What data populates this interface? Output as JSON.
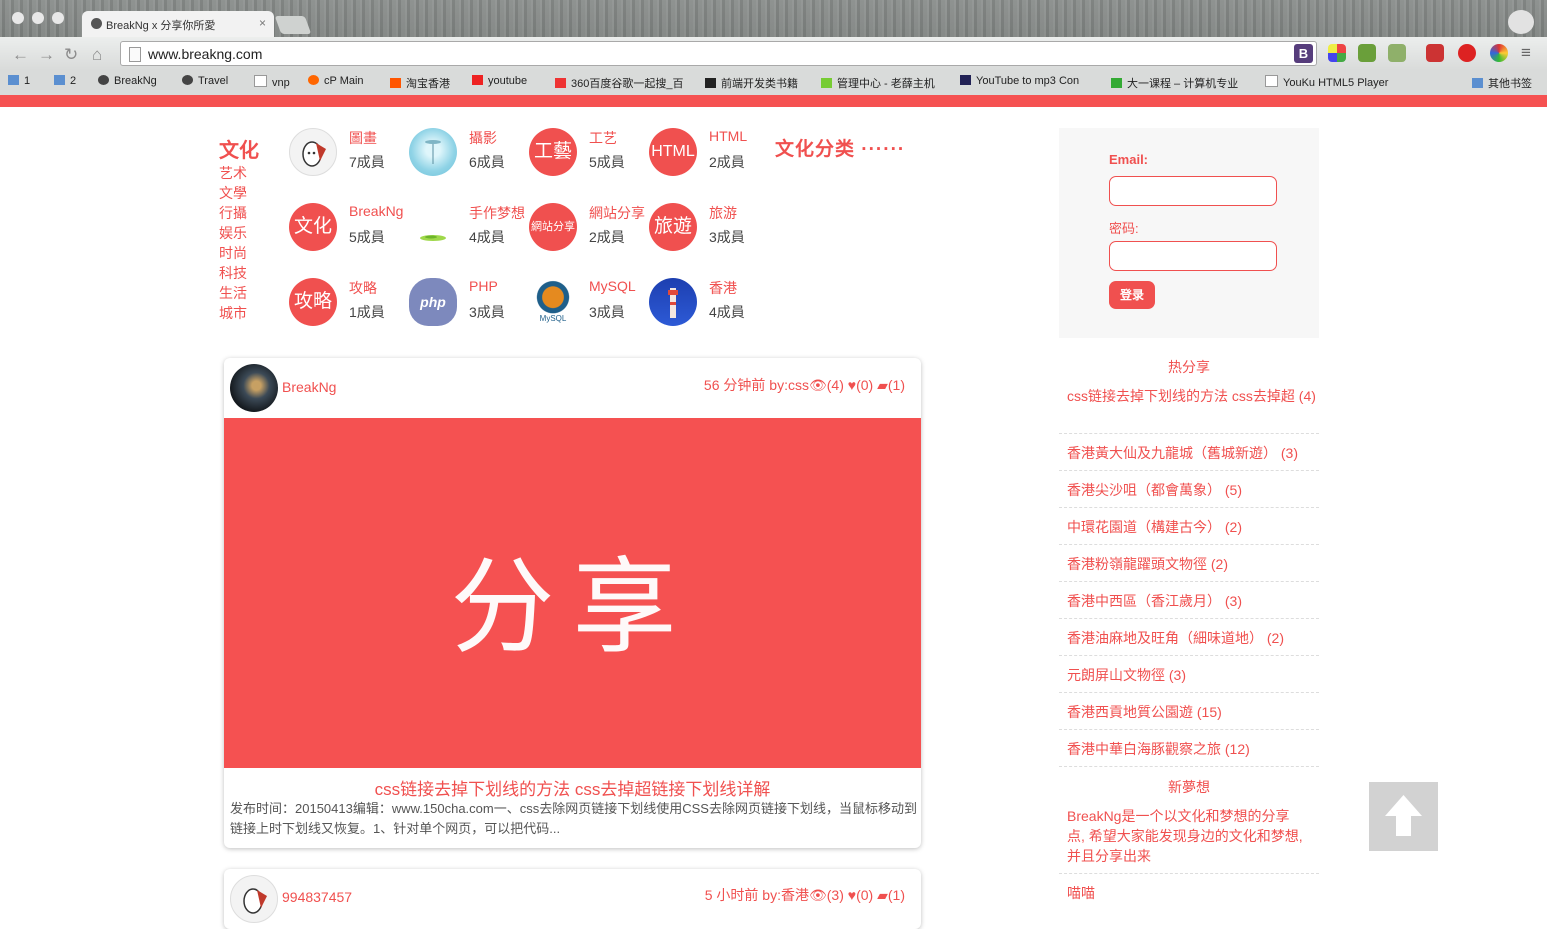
{
  "browser": {
    "tab_title": "BreakNg x 分享你所愛",
    "tab_close": "×",
    "url": "www.breakng.com",
    "url_ext_label": "B",
    "bookmarks": [
      {
        "label": "1"
      },
      {
        "label": "2"
      },
      {
        "label": "BreakNg"
      },
      {
        "label": "Travel"
      },
      {
        "label": "vnp"
      },
      {
        "label": "cP Main"
      },
      {
        "label": "淘宝香港"
      },
      {
        "label": "youtube"
      },
      {
        "label": "360百度谷歌一起搜_百"
      },
      {
        "label": "前端开发类书籍"
      },
      {
        "label": "管理中心 - 老薛主机"
      },
      {
        "label": "YouTube to mp3 Con"
      },
      {
        "label": "大一课程 – 计算机专业"
      },
      {
        "label": "YouKu HTML5 Player"
      },
      {
        "label": "其他书签"
      }
    ],
    "accent": "#f55151"
  },
  "categories": {
    "title": "文化",
    "list": [
      "艺术",
      "文學",
      "行攝",
      "娱乐",
      "时尚",
      "科技",
      "生活",
      "城市"
    ],
    "more": "文化分类 ······",
    "groups": [
      {
        "name": "圖畫",
        "count": "7成員",
        "icon": "",
        "icon_name": "drawing-character-icon"
      },
      {
        "name": "攝影",
        "count": "6成員",
        "icon": "",
        "icon_name": "camera-sky-icon"
      },
      {
        "name": "工艺",
        "count": "5成員",
        "icon": "工藝",
        "icon_name": "craft-icon"
      },
      {
        "name": "HTML",
        "count": "2成員",
        "icon": "HTML",
        "icon_name": "html-icon"
      },
      {
        "name": "BreakNg",
        "count": "5成員",
        "icon": "文化",
        "icon_name": "culture-icon"
      },
      {
        "name": "手作梦想",
        "count": "4成員",
        "icon": "",
        "icon_name": "handmade-icon"
      },
      {
        "name": "網站分享",
        "count": "2成員",
        "icon": "網站分享",
        "icon_name": "website-share-icon"
      },
      {
        "name": "旅游",
        "count": "3成員",
        "icon": "旅遊",
        "icon_name": "travel-icon"
      },
      {
        "name": "攻略",
        "count": "1成員",
        "icon": "攻略",
        "icon_name": "guide-icon"
      },
      {
        "name": "PHP",
        "count": "3成員",
        "icon": "php",
        "icon_name": "php-elephant-icon"
      },
      {
        "name": "MySQL",
        "count": "3成員",
        "icon": "MySQL",
        "icon_name": "mysql-icon"
      },
      {
        "name": "香港",
        "count": "4成員",
        "icon": "",
        "icon_name": "hongkong-tower-icon"
      }
    ]
  },
  "posts": [
    {
      "author": "BreakNg",
      "time": "56 分钟前",
      "by": "by:css",
      "views": "(4)",
      "likes": "(0)",
      "comments": "(1)",
      "hero_text": "分享",
      "title": "css链接去掉下划线的方法 css去掉超链接下划线详解",
      "excerpt": "发布时间：20150413编辑：www.150cha.com一、css去除网页链接下划线使用CSS去除网页链接下划线，当鼠标移动到链接上时下划线又恢复。1、针对单个网页，可以把代码..."
    },
    {
      "author": "994837457",
      "time": "5 小时前",
      "by": "by:香港",
      "views": "(3)",
      "likes": "(0)",
      "comments": "(1)"
    }
  ],
  "login": {
    "email_label": "Email:",
    "password_label": "密码:",
    "submit": "登录"
  },
  "hot": {
    "heading": "热分享",
    "items": [
      "css链接去掉下划线的方法 css去掉超 (4)",
      "香港黃大仙及九龍城（舊城新遊） (3)",
      "香港尖沙咀（都會萬象） (5)",
      "中環花園道（構建古今） (2)",
      "香港粉嶺龍躍頭文物徑 (2)",
      "香港中西區（香江歲月） (3)",
      "香港油麻地及旺角（細味道地） (2)",
      "元朗屏山文物徑 (3)",
      "香港西貢地質公園遊 (15)",
      "香港中華白海豚觀察之旅 (12)"
    ]
  },
  "dream": {
    "heading": "新夢想",
    "items": [
      "BreakNg是一个以文化和梦想的分享点, 希望大家能发现身边的文化和梦想, 并且分享出来",
      "喵喵"
    ]
  }
}
